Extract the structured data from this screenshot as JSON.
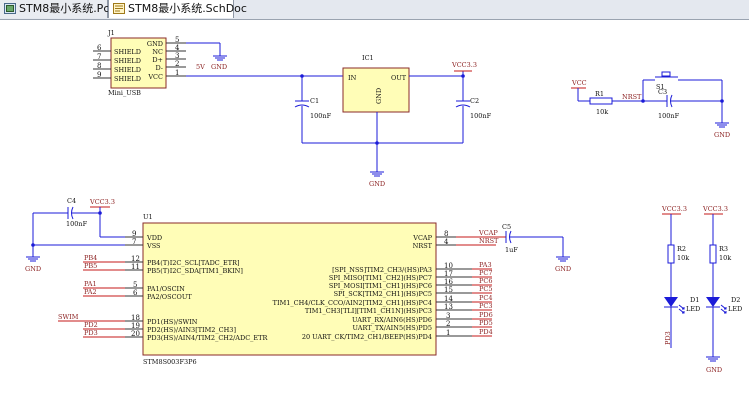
{
  "tabs": [
    {
      "label": "STM8最小系统.PcbDoc",
      "icon": "pcb-doc-icon"
    },
    {
      "label": "STM8最小系统.SchDoc",
      "icon": "sch-doc-icon"
    }
  ],
  "j1": {
    "ref": "J1",
    "name": "Mini_USB",
    "left_pins": [
      "SHIELD",
      "SHIELD",
      "SHIELD",
      "SHIELD"
    ],
    "left_nums": [
      "6",
      "7",
      "8",
      "9"
    ],
    "right_pins": [
      "GND",
      "NC",
      "D+",
      "D-",
      "VCC"
    ],
    "right_nums": [
      "5",
      "4",
      "3",
      "2",
      "1"
    ]
  },
  "ic1": {
    "ref": "IC1",
    "in": "IN",
    "out": "OUT",
    "gnd": "GND"
  },
  "labels": {
    "vbus": "5V",
    "vcc33": "VCC3.3",
    "vcc": "VCC",
    "gnd": "GND",
    "c1_ref": "C1",
    "c1_val": "100nF",
    "c2_ref": "C2",
    "c2_val": "100nF",
    "r1_ref": "R1",
    "r1_val": "10k",
    "s1_ref": "S1",
    "c3_ref": "C3",
    "c3_val": "100nF",
    "nrst": "NRST",
    "c4_ref": "C4",
    "c4_val": "100nF",
    "c5_ref": "C5",
    "c5_val": "1uF",
    "vcap": "VCAP",
    "r2_ref": "R2",
    "r2_val": "10k",
    "r3_ref": "R3",
    "r3_val": "10k",
    "d1_ref": "D1",
    "d2_ref": "D2",
    "led": "LED",
    "pd3": "PD3"
  },
  "u1": {
    "ref": "U1",
    "name": "STM8S003F3P6",
    "top_left": [
      {
        "pin": "VDD",
        "num": "9"
      },
      {
        "pin": "VSS",
        "num": "7"
      }
    ],
    "top_right": [
      {
        "pin": "VCAP",
        "num": "8"
      },
      {
        "pin": "NRST",
        "num": "4"
      }
    ],
    "left": [
      {
        "net": "PB4",
        "num": "12",
        "pin": "PB4(T)I2C_SCL[TADC_ETR]"
      },
      {
        "net": "PB5",
        "num": "11",
        "pin": "PB5(T)I2C_SDA[TIM1_BKIN]"
      },
      {
        "net": "PA1",
        "num": "5",
        "pin": "PA1/OSCIN"
      },
      {
        "net": "PA2",
        "num": "6",
        "pin": "PA2/OSCOUT"
      },
      {
        "net": "SWIM",
        "num": "18",
        "pin": "PD1(HS)/SWIN"
      },
      {
        "net": "PD2",
        "num": "19",
        "pin": "PD2(HS)/AIN3[TIM2_CH3]"
      },
      {
        "net": "PD3",
        "num": "20",
        "pin": "PD3(HS)/AIN4/TIM2_CH2/ADC_ETR"
      }
    ],
    "right": [
      {
        "net": "PA3",
        "num": "10",
        "pin": "[SPI_NSS]TIM2_CH3/(HS)PA3"
      },
      {
        "net": "PC7",
        "num": "17",
        "pin": "SPI_MISO[TIM1_CH2](HS)PC7"
      },
      {
        "net": "PC6",
        "num": "16",
        "pin": "SPI_MOSI[TIM1_CH1](HS)PC6"
      },
      {
        "net": "PC5",
        "num": "15",
        "pin": "SPI_SCK[TIM2_CH1](HS)PC5"
      },
      {
        "net": "PC4",
        "num": "14",
        "pin": "TIM1_CH4/CLK_CCO/AIN2[TIM2_CH1](HS)PC4"
      },
      {
        "net": "PC3",
        "num": "13",
        "pin": "TIM1_CH3[TLI][TIM1_CH1N](HS)PC3"
      },
      {
        "net": "PD6",
        "num": "3",
        "pin": "UART_RX/AIN6(HS)PD6"
      },
      {
        "net": "PD5",
        "num": "2",
        "pin": "UART_TX/AIN5(HS)PD5"
      },
      {
        "net": "PD4",
        "num": "1",
        "pin": "20 UART_CK/TIM2_CH1/BEEP(HS)PD4"
      }
    ]
  }
}
